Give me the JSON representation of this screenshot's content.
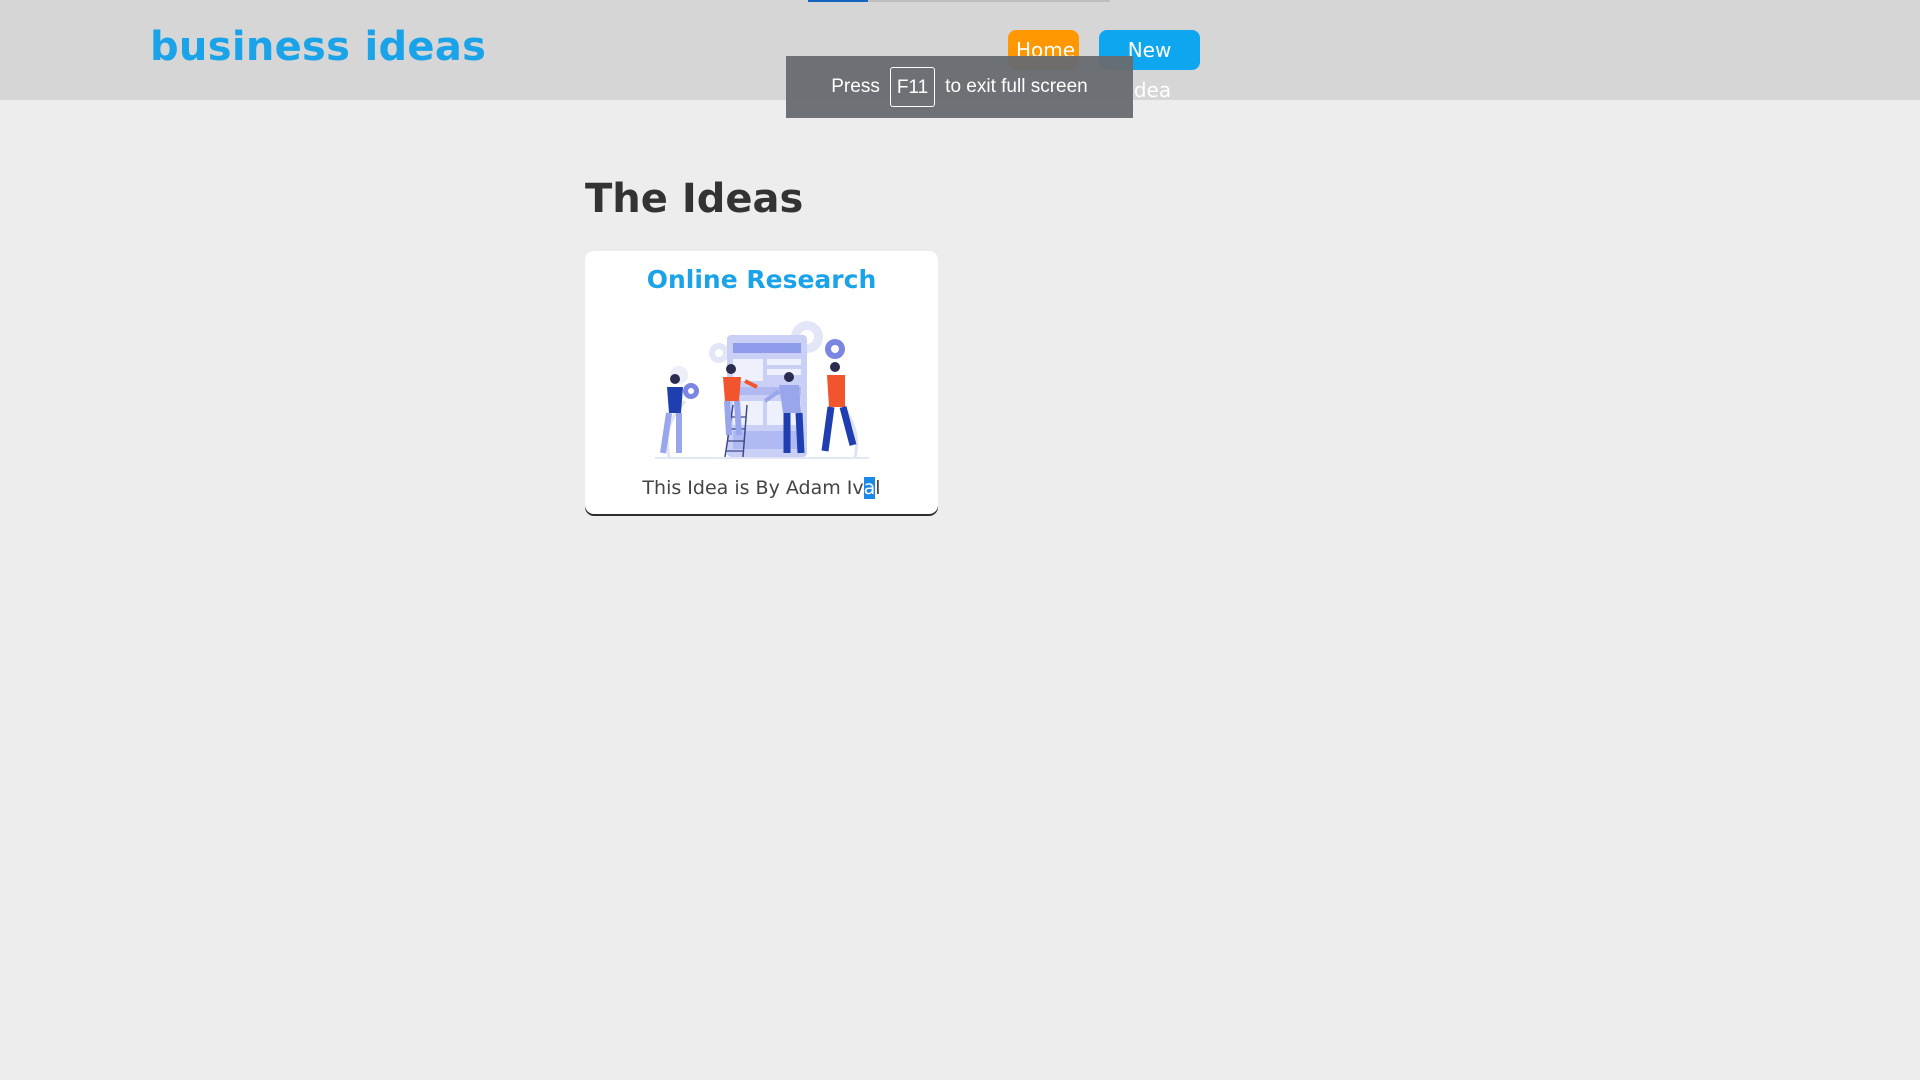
{
  "header": {
    "logo": "business ideas",
    "nav": {
      "home_label": "Home",
      "new_idea_label": "New Idea"
    }
  },
  "fullscreen_notice": {
    "press": "Press",
    "key": "F11",
    "rest": "to exit full screen"
  },
  "main": {
    "title": "The Ideas",
    "cards": [
      {
        "title": "Online Research",
        "author_prefix": "This Idea is By Adam Iv",
        "author_selected": "a",
        "author_suffix": "l",
        "illustration": "team-building-website-illustration"
      }
    ]
  },
  "colors": {
    "brand": "#1aa3e8",
    "home_button": "#ff9800",
    "new_idea_button": "#0fa6f0",
    "header_bg": "#d6d6d6",
    "page_bg": "#ededed"
  }
}
